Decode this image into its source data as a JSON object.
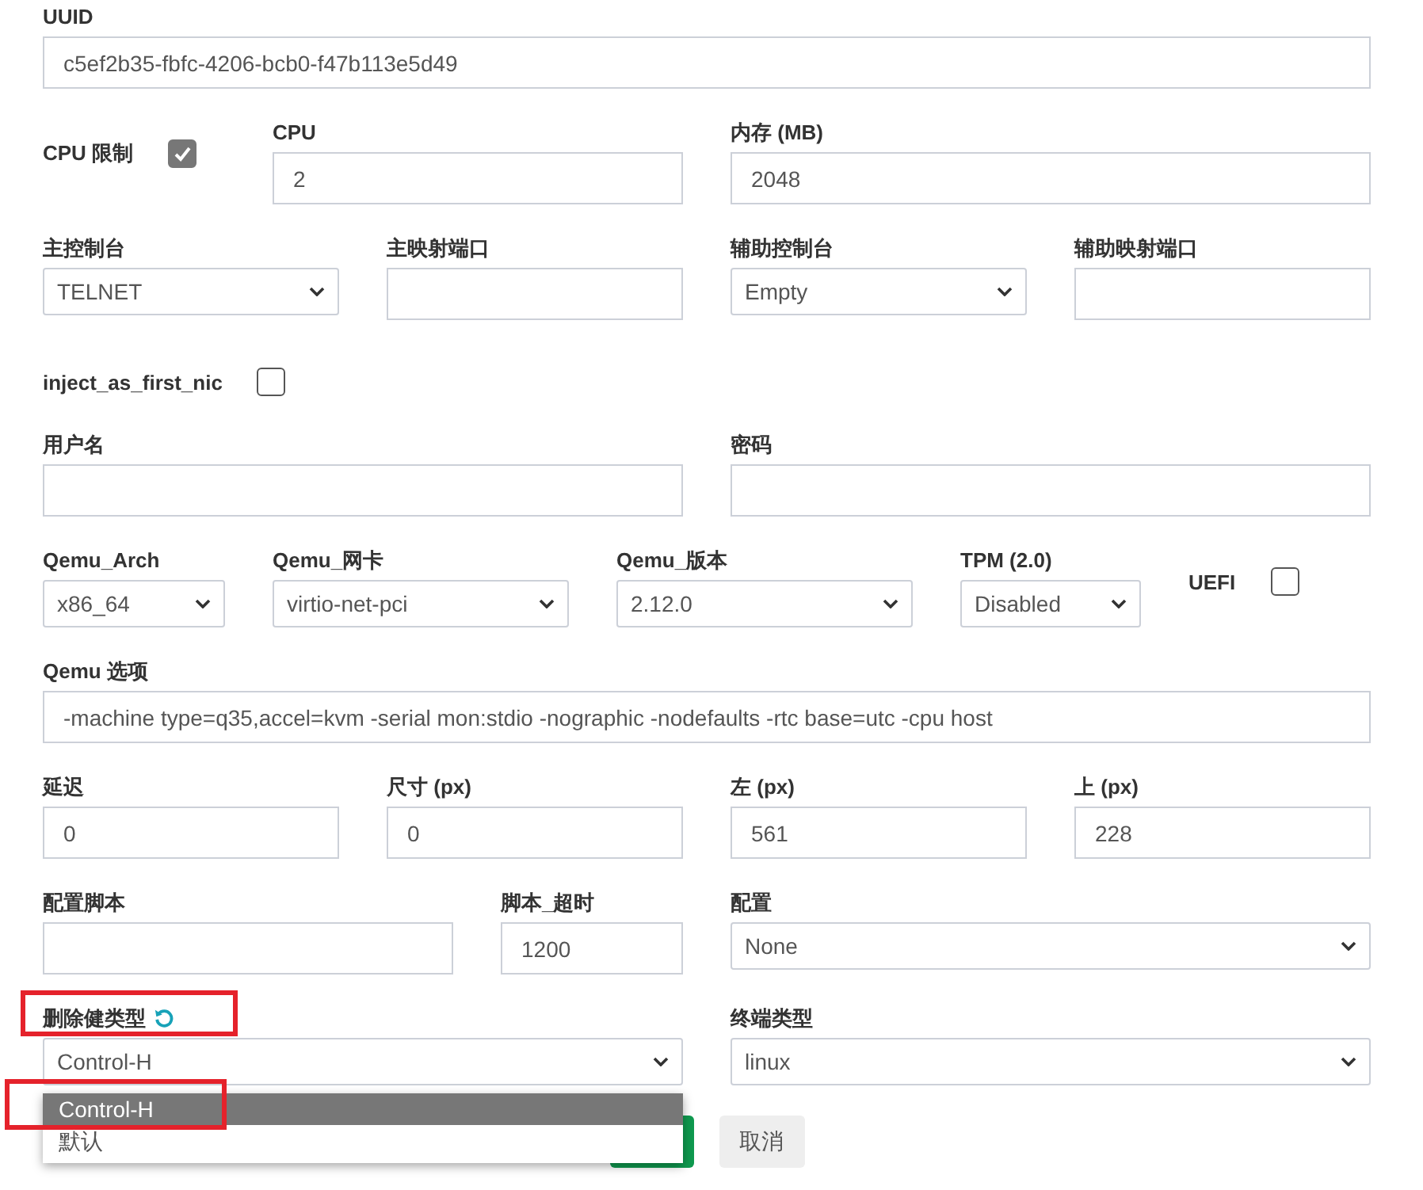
{
  "rows": [
    {
      "fields": [
        {
          "kind": "input",
          "label": "UUID",
          "value": "c5ef2b35-fbfc-4206-bcb0-f47b113e5d49"
        }
      ]
    },
    {
      "fields": [
        {
          "kind": "checkbox",
          "label": "CPU 限制",
          "checked": true
        },
        {
          "kind": "input",
          "label": "CPU",
          "value": "2"
        },
        {
          "kind": "input",
          "label": "内存 (MB)",
          "value": "2048"
        }
      ]
    },
    {
      "fields": [
        {
          "kind": "select",
          "label": "主控制台",
          "value": "TELNET"
        },
        {
          "kind": "input",
          "label": "主映射端口"
        },
        {
          "kind": "select",
          "label": "辅助控制台",
          "value": "Empty"
        },
        {
          "kind": "input",
          "label": "辅助映射端口"
        }
      ]
    },
    {
      "fields": [
        {
          "kind": "checkbox",
          "label": "inject_as_first_nic",
          "checked": false
        }
      ]
    },
    {
      "fields": [
        {
          "kind": "input",
          "label": "用户名"
        },
        {
          "kind": "input",
          "label": "密码"
        }
      ]
    },
    {
      "fields": [
        {
          "kind": "select",
          "label": "Qemu_Arch",
          "value": "x86_64"
        },
        {
          "kind": "select",
          "label": "Qemu_网卡",
          "value": "virtio-net-pci"
        },
        {
          "kind": "select",
          "label": "Qemu_版本",
          "value": "2.12.0"
        },
        {
          "kind": "select",
          "label": "TPM (2.0)",
          "value": "Disabled"
        },
        {
          "kind": "checkbox",
          "label": "UEFI",
          "checked": false
        }
      ]
    },
    {
      "fields": [
        {
          "kind": "input",
          "label": "Qemu 选项",
          "value": "-machine type=q35,accel=kvm -serial mon:stdio -nographic -nodefaults -rtc base=utc -cpu host"
        }
      ]
    },
    {
      "fields": [
        {
          "kind": "input",
          "label": "延迟",
          "value": "0"
        },
        {
          "kind": "input",
          "label": "尺寸 (px)",
          "value": "0"
        },
        {
          "kind": "input",
          "label": "左 (px)",
          "value": "561"
        },
        {
          "kind": "input",
          "label": "上 (px)",
          "value": "228"
        }
      ]
    },
    {
      "fields": [
        {
          "kind": "input",
          "label": "配置脚本"
        },
        {
          "kind": "input",
          "label": "脚本_超时",
          "value": "1200"
        },
        {
          "kind": "select",
          "label": "配置",
          "value": "None"
        }
      ]
    },
    {
      "fields": [
        {
          "kind": "select",
          "label": "删除健类型",
          "value": "Control-H",
          "reset_icon": true,
          "highlighted": true,
          "open": true,
          "options": [
            {
              "label": "Control-H",
              "selected": true,
              "highlighted": true
            },
            {
              "label": "默认",
              "selected": false,
              "highlighted": false
            }
          ]
        },
        {
          "kind": "select",
          "label": "终端类型",
          "value": "linux"
        }
      ]
    }
  ],
  "buttons": [
    {
      "kind": "primary"
    },
    {
      "kind": "secondary",
      "label": "取消"
    }
  ]
}
